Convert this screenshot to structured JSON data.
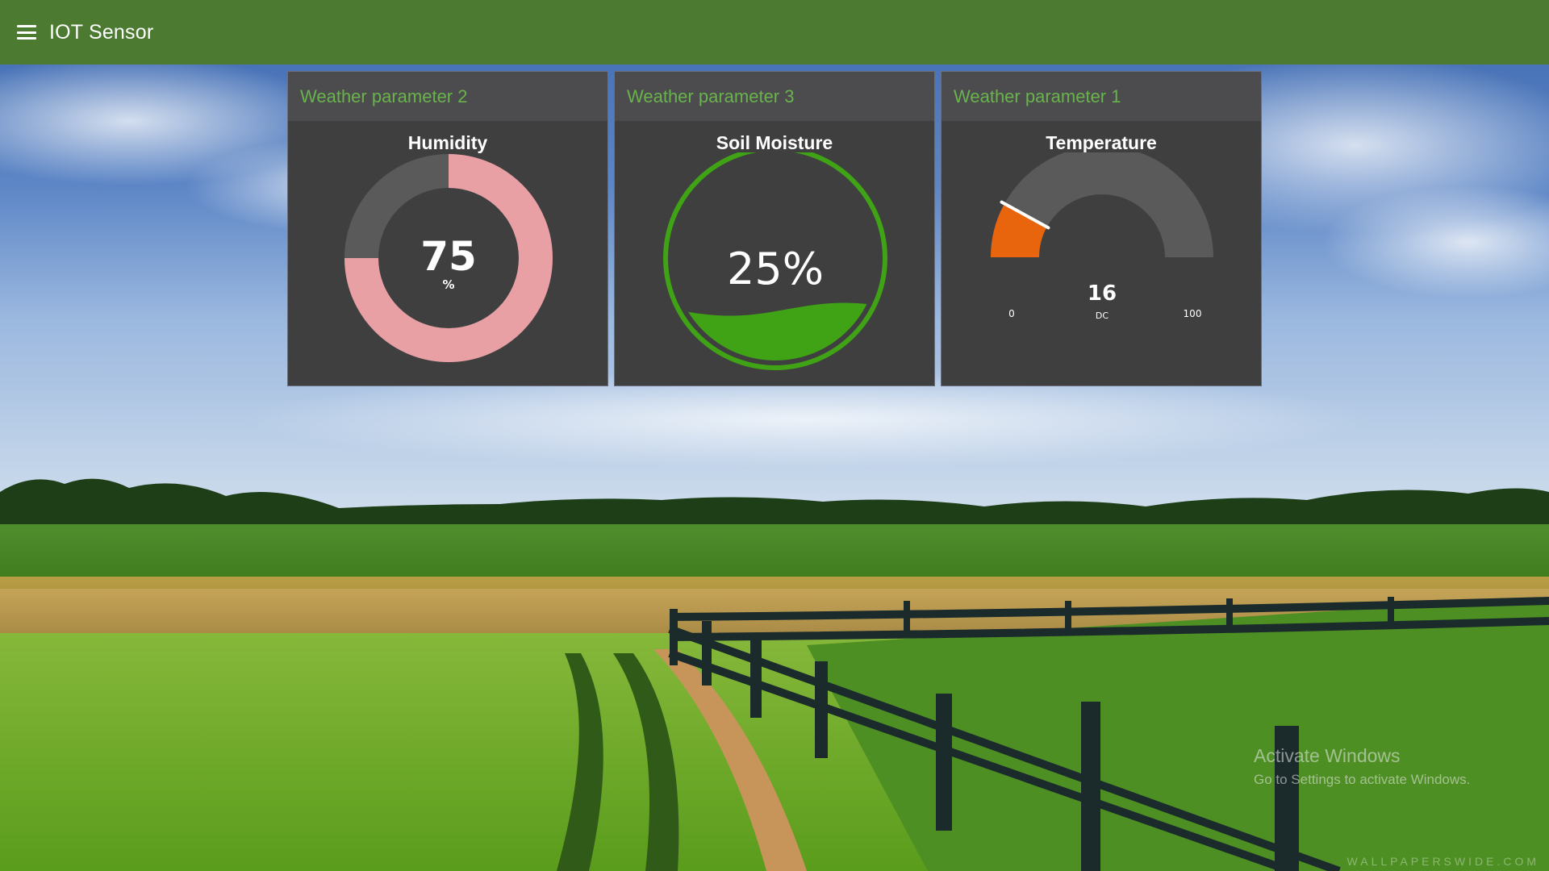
{
  "app": {
    "title": "IOT Sensor",
    "menu_icon": "hamburger-menu-icon",
    "toolbar_color": "#4b7a30"
  },
  "cards": [
    {
      "header": "Weather parameter 2",
      "gauge": {
        "type": "donut",
        "label": "Humidity",
        "value": "75",
        "unit": "%",
        "fraction": 0.75,
        "fill_color": "#e8a0a4",
        "track_color": "#5a5a5a"
      }
    },
    {
      "header": "Weather parameter 3",
      "gauge": {
        "type": "liquid-fill",
        "label": "Soil Moisture",
        "value": "25%",
        "fraction": 0.25,
        "fill_color": "#3fa315"
      }
    },
    {
      "header": "Weather parameter 1",
      "gauge": {
        "type": "semicircle",
        "label": "Temperature",
        "value": "16",
        "unit": "DC",
        "min": "0",
        "max": "100",
        "fraction": 0.16,
        "fill_color": "#e8650e",
        "track_color": "#5a5a5a"
      }
    }
  ],
  "watermark": {
    "title": "Activate Windows",
    "subtitle": "Go to Settings to activate Windows."
  },
  "credit": "WALLPAPERSWIDE.COM"
}
